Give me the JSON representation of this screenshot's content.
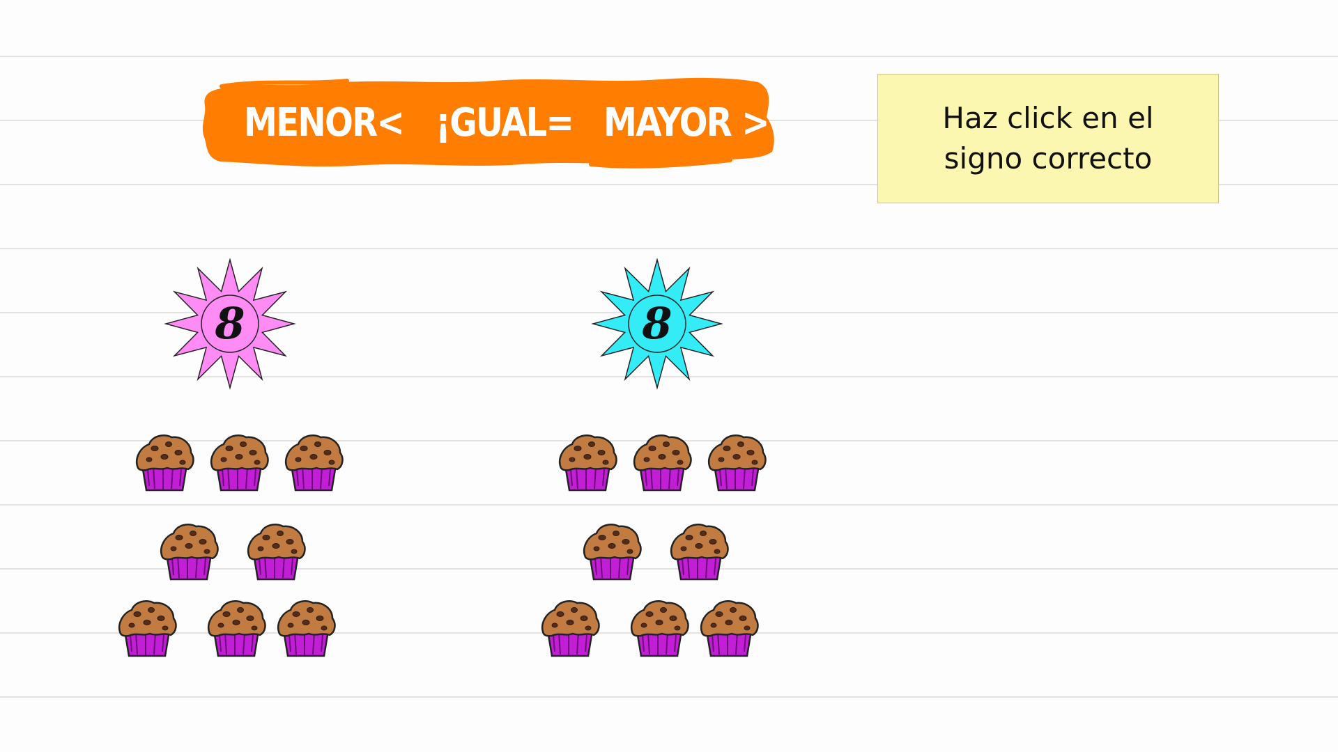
{
  "banner": {
    "less": "MENOR<",
    "equal": "¡GUAL=",
    "greater": "MAYOR >",
    "color": "#ff7d00"
  },
  "instruction": "Haz click en el signo correcto",
  "groups": [
    {
      "number": "8",
      "badge_color": "#ff8cf5",
      "muffin_count": 8
    },
    {
      "number": "8",
      "badge_color": "#33ecf6",
      "muffin_count": 8
    }
  ],
  "muffin": {
    "top_color": "#c27b40",
    "cup_color": "#c11ed6",
    "chip_color": "#5a2a12"
  }
}
